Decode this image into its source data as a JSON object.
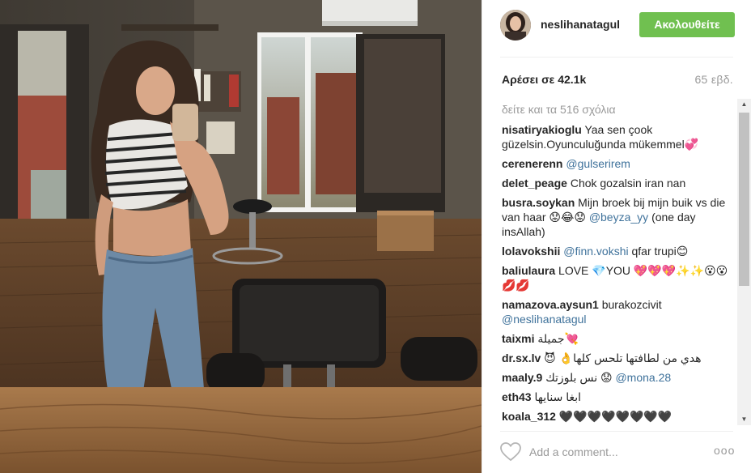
{
  "post": {
    "photo_alt": "Selfie in a mirror at a hair salon"
  },
  "header": {
    "username": "neslihanatagul",
    "follow_label": "Ακολουθείτε"
  },
  "stats": {
    "likes": "Αρέσει σε 42.1k",
    "time": "65 εβδ."
  },
  "comments": {
    "view_all": "δείτε και τα 516 σχόλια",
    "items": [
      {
        "user": "nisatiryakioglu",
        "text": "Yaa sen çook güzelsin.Oyunculuğunda mükemmel💞",
        "mention": "",
        "after": ""
      },
      {
        "user": "cerenerenn",
        "text": "",
        "mention": "@gulserirem",
        "after": ""
      },
      {
        "user": "delet_peage",
        "text": "Chok gozalsin iran nan",
        "mention": "",
        "after": ""
      },
      {
        "user": "busra.soykan",
        "text": "Mijn broek bij mijn buik vs die van haar 😟😂😟",
        "mention": "@beyza_yy",
        "after": "(one day insAllah)"
      },
      {
        "user": "lolavokshii",
        "text": "",
        "mention": "@finn.vokshi",
        "after": "qfar trupi😊"
      },
      {
        "user": "baliulaura",
        "text": "LOVE 💎YOU 💖💖💖✨✨😮😮 💋💋",
        "mention": "",
        "after": ""
      },
      {
        "user": "namazova.aysun1",
        "text": "burakozcivit",
        "mention": "@neslihanatagul",
        "after": ""
      },
      {
        "user": "taixmi",
        "text": "جميلة💘",
        "mention": "",
        "after": ""
      },
      {
        "user": "dr.sx.lv",
        "text": "😈 👌هدي من لطافتها تلحس كلها",
        "mention": "",
        "after": ""
      },
      {
        "user": "maaly.9",
        "text": "نس بلوزتك 😟",
        "mention": "@mona.28",
        "after": ""
      },
      {
        "user": "eth43",
        "text": "ابغا سنايها",
        "mention": "",
        "after": ""
      },
      {
        "user": "koala_312",
        "text": "🖤🖤🖤🖤🖤🖤🖤🖤",
        "mention": "",
        "after": ""
      }
    ]
  },
  "composer": {
    "placeholder": "Add a comment...",
    "more_label": "ooo"
  },
  "icons": {
    "heart": "heart-icon",
    "more": "more-options-icon"
  },
  "colors": {
    "follow_bg": "#70c050",
    "mention": "#3f729b",
    "muted": "#999999"
  }
}
